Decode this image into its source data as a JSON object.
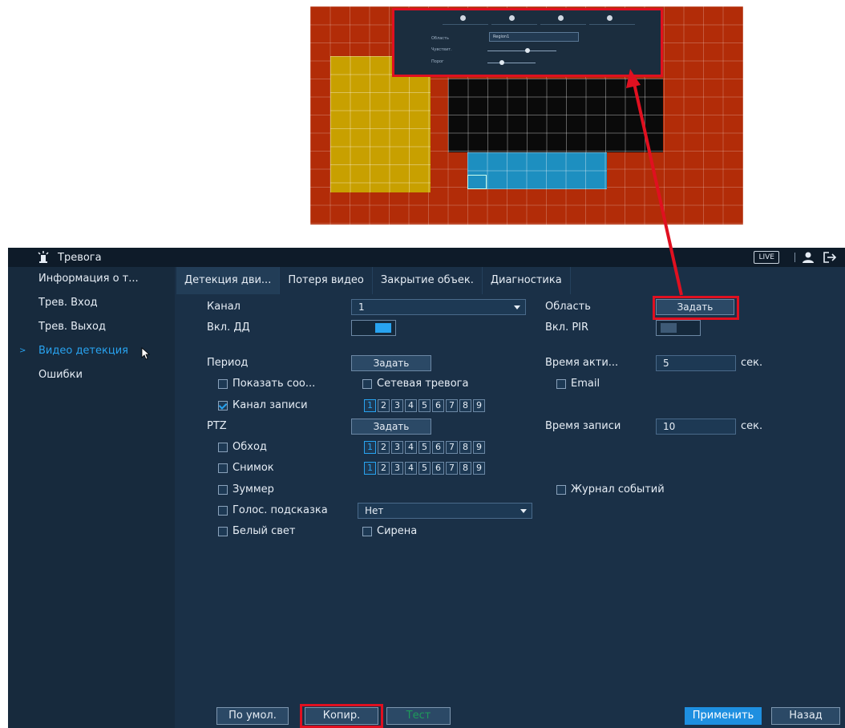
{
  "preview": {
    "mini_panel": {
      "row1_label": "Область",
      "row1_value": "Region1",
      "row2_label": "Чувствит.",
      "row3_label": "Порог",
      "row2_value": "",
      "row3_value": ""
    }
  },
  "window": {
    "title": "Тревога",
    "live_badge": "LIVE"
  },
  "sidebar": {
    "items": [
      {
        "label": "Информация о т..."
      },
      {
        "label": "Трев. Вход"
      },
      {
        "label": "Трев. Выход"
      },
      {
        "label": "Видео детекция"
      },
      {
        "label": "Ошибки"
      }
    ]
  },
  "tabs": [
    {
      "label": "Детекция дви..."
    },
    {
      "label": "Потеря видео"
    },
    {
      "label": "Закрытие объек."
    },
    {
      "label": "Диагностика"
    }
  ],
  "form": {
    "channel_label": "Канал",
    "channel_value": "1",
    "area_label": "Область",
    "area_button": "Задать",
    "md_enable_label": "Вкл. ДД",
    "pir_enable_label": "Вкл. PIR",
    "period_label": "Период",
    "period_button": "Задать",
    "anti_dither_label": "Время акти...",
    "anti_dither_value": "5",
    "anti_dither_unit": "сек.",
    "show_message_label": "Показать соо...",
    "network_alarm_label": "Сетевая тревога",
    "email_label": "Email",
    "record_channel_label": "Канал записи",
    "ptz_label": "PTZ",
    "ptz_button": "Задать",
    "post_record_label": "Время записи",
    "post_record_value": "10",
    "post_record_unit": "сек.",
    "tour_label": "Обход",
    "snapshot_label": "Снимок",
    "buzzer_label": "Зуммер",
    "log_label": "Журнал событий",
    "voice_label": "Голос. подсказка",
    "voice_value": "Нет",
    "white_light_label": "Белый свет",
    "siren_label": "Сирена",
    "channel_numbers": [
      "1",
      "2",
      "3",
      "4",
      "5",
      "6",
      "7",
      "8",
      "9"
    ]
  },
  "footer": {
    "default_button": "По умол.",
    "copy_button": "Копир.",
    "test_button": "Тест",
    "apply_button": "Применить",
    "back_button": "Назад"
  },
  "colors": {
    "highlight": "#e01020",
    "accent": "#28a3f0",
    "window_bg": "#1a3047"
  }
}
